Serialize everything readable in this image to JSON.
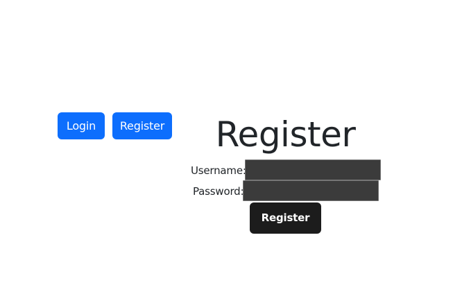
{
  "nav": {
    "login_label": "Login",
    "register_label": "Register"
  },
  "form": {
    "title": "Register",
    "username_label": "Username:",
    "username_value": "",
    "password_label": "Password:",
    "password_value": "",
    "submit_label": "Register"
  },
  "colors": {
    "primary": "#0d6efd",
    "dark": "#1c1c1c",
    "input_bg": "#3b3b3b",
    "text": "#212529"
  }
}
